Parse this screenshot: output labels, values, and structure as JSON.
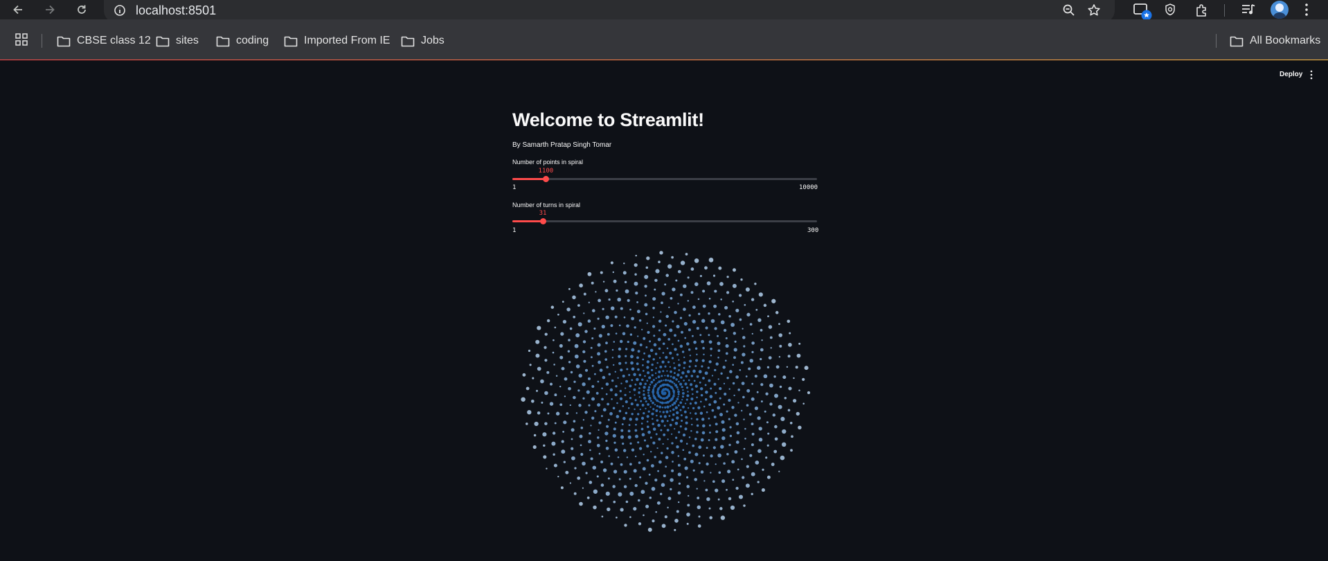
{
  "browser": {
    "url": "localhost:8501",
    "bookmarks": [
      "CBSE class 12",
      "sites",
      "coding",
      "Imported From IE",
      "Jobs"
    ],
    "all_bookmarks": "All Bookmarks"
  },
  "app": {
    "deploy_label": "Deploy",
    "title": "Welcome to Streamlit!",
    "byline": "By Samarth Pratap Singh Tomar"
  },
  "sliders": [
    {
      "label": "Number of points in spiral",
      "value": "1100",
      "min": "1",
      "max": "10000",
      "fraction": 0.11
    },
    {
      "label": "Number of turns in spiral",
      "value": "31",
      "min": "1",
      "max": "300",
      "fraction": 0.1
    }
  ],
  "chart_data": {
    "type": "scatter",
    "description_fields": {
      "num_points": 1100,
      "num_turns": 31
    },
    "colors": {
      "inner": "#1f5fa6",
      "outer": "#9fb7cf"
    }
  }
}
